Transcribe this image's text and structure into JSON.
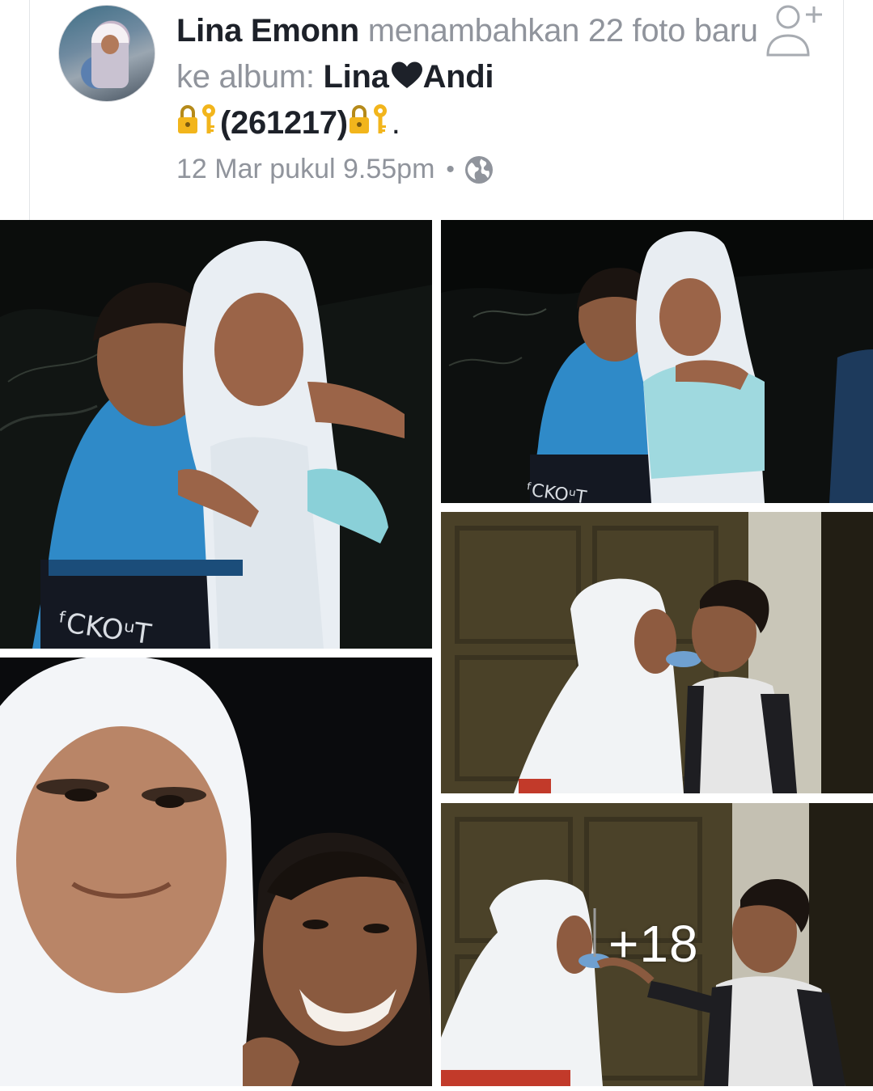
{
  "post": {
    "author": "Lina Emonn",
    "action_text": " menambahkan 22 foto baru ke album: ",
    "album_name_part1": "Lina",
    "album_name_part2": "Andi",
    "album_code": "(261217)",
    "album_suffix": ".",
    "timestamp": "12 Mar pukul 9.55pm",
    "separator": "•",
    "privacy_icon": "globe-icon"
  },
  "icons": {
    "add_friend": "add-friend-icon",
    "heart": "heart-icon",
    "lock_key": "lock-key-icon"
  },
  "gallery": {
    "more_count": "+18",
    "photos": [
      {
        "name": "photo-1",
        "description_icon": "photo"
      },
      {
        "name": "photo-2",
        "description_icon": "photo"
      },
      {
        "name": "photo-3",
        "description_icon": "photo"
      },
      {
        "name": "photo-4",
        "description_icon": "photo"
      },
      {
        "name": "photo-5",
        "description_icon": "photo"
      }
    ]
  },
  "colors": {
    "primary_text": "#1d2129",
    "secondary_text": "#90949c",
    "border": "#e3e5e8"
  }
}
